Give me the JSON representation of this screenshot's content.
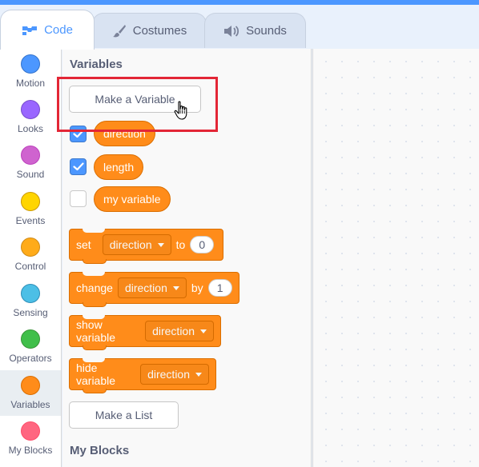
{
  "tabs": [
    {
      "label": "Code",
      "icon": "code-icon",
      "active": true
    },
    {
      "label": "Costumes",
      "icon": "brush-icon",
      "active": false
    },
    {
      "label": "Sounds",
      "icon": "speaker-icon",
      "active": false
    }
  ],
  "categories": [
    {
      "label": "Motion",
      "color": "#4c97ff"
    },
    {
      "label": "Looks",
      "color": "#9966ff"
    },
    {
      "label": "Sound",
      "color": "#cf63cf"
    },
    {
      "label": "Events",
      "color": "#ffd500"
    },
    {
      "label": "Control",
      "color": "#ffab19"
    },
    {
      "label": "Sensing",
      "color": "#4cbfe6"
    },
    {
      "label": "Operators",
      "color": "#40bf4a"
    },
    {
      "label": "Variables",
      "color": "#ff8c1a",
      "selected": true
    },
    {
      "label": "My Blocks",
      "color": "#ff6680"
    }
  ],
  "palette": {
    "variables_title": "Variables",
    "make_variable_label": "Make a Variable",
    "variables": [
      {
        "name": "direction",
        "checked": true
      },
      {
        "name": "length",
        "checked": true
      },
      {
        "name": "my variable",
        "checked": false
      }
    ],
    "blocks": {
      "set": {
        "label": "set",
        "variable": "direction",
        "to": "to",
        "value": "0"
      },
      "change": {
        "label": "change",
        "variable": "direction",
        "by": "by",
        "value": "1"
      },
      "show": {
        "label": "show variable",
        "variable": "direction"
      },
      "hide": {
        "label": "hide variable",
        "variable": "direction"
      }
    },
    "make_list_label": "Make a List",
    "my_blocks_title": "My Blocks"
  },
  "colors": {
    "accent": "#4c97ff",
    "variables_orange": "#ff8c1a",
    "highlight_red": "#e32636"
  }
}
